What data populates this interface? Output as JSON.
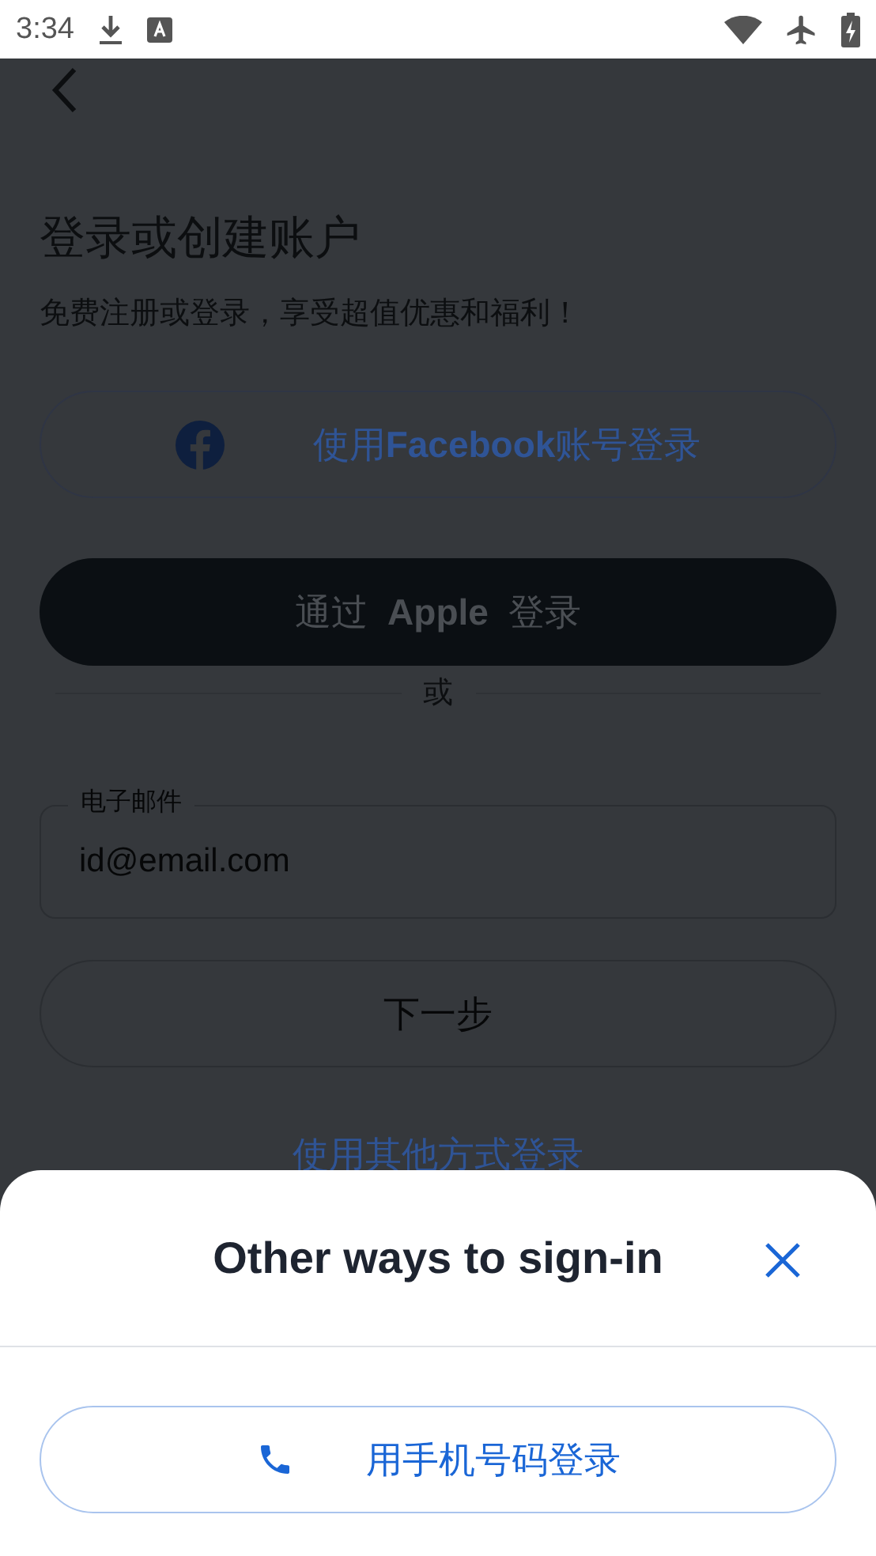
{
  "status_bar": {
    "time": "3:34"
  },
  "header": {
    "title": "登录或创建账户",
    "subtitle": "免费注册或登录，享受超值优惠和福利！"
  },
  "buttons": [
    {
      "kind": "facebook",
      "label": "使用**Facebook**账号登录"
    },
    {
      "kind": "apple",
      "label": "通过 **Apple** 登录"
    }
  ],
  "divider": "或",
  "email_field": {
    "label": "电子邮件",
    "placeholder": "id@email.com"
  },
  "next_button": {
    "label": "下一步",
    "disabled": true
  },
  "other_link": "使用其他方式登录",
  "sheet": {
    "title": "Other ways to sign-in",
    "options": [
      {
        "kind": "phone",
        "label": "用手机号码登录"
      }
    ]
  }
}
